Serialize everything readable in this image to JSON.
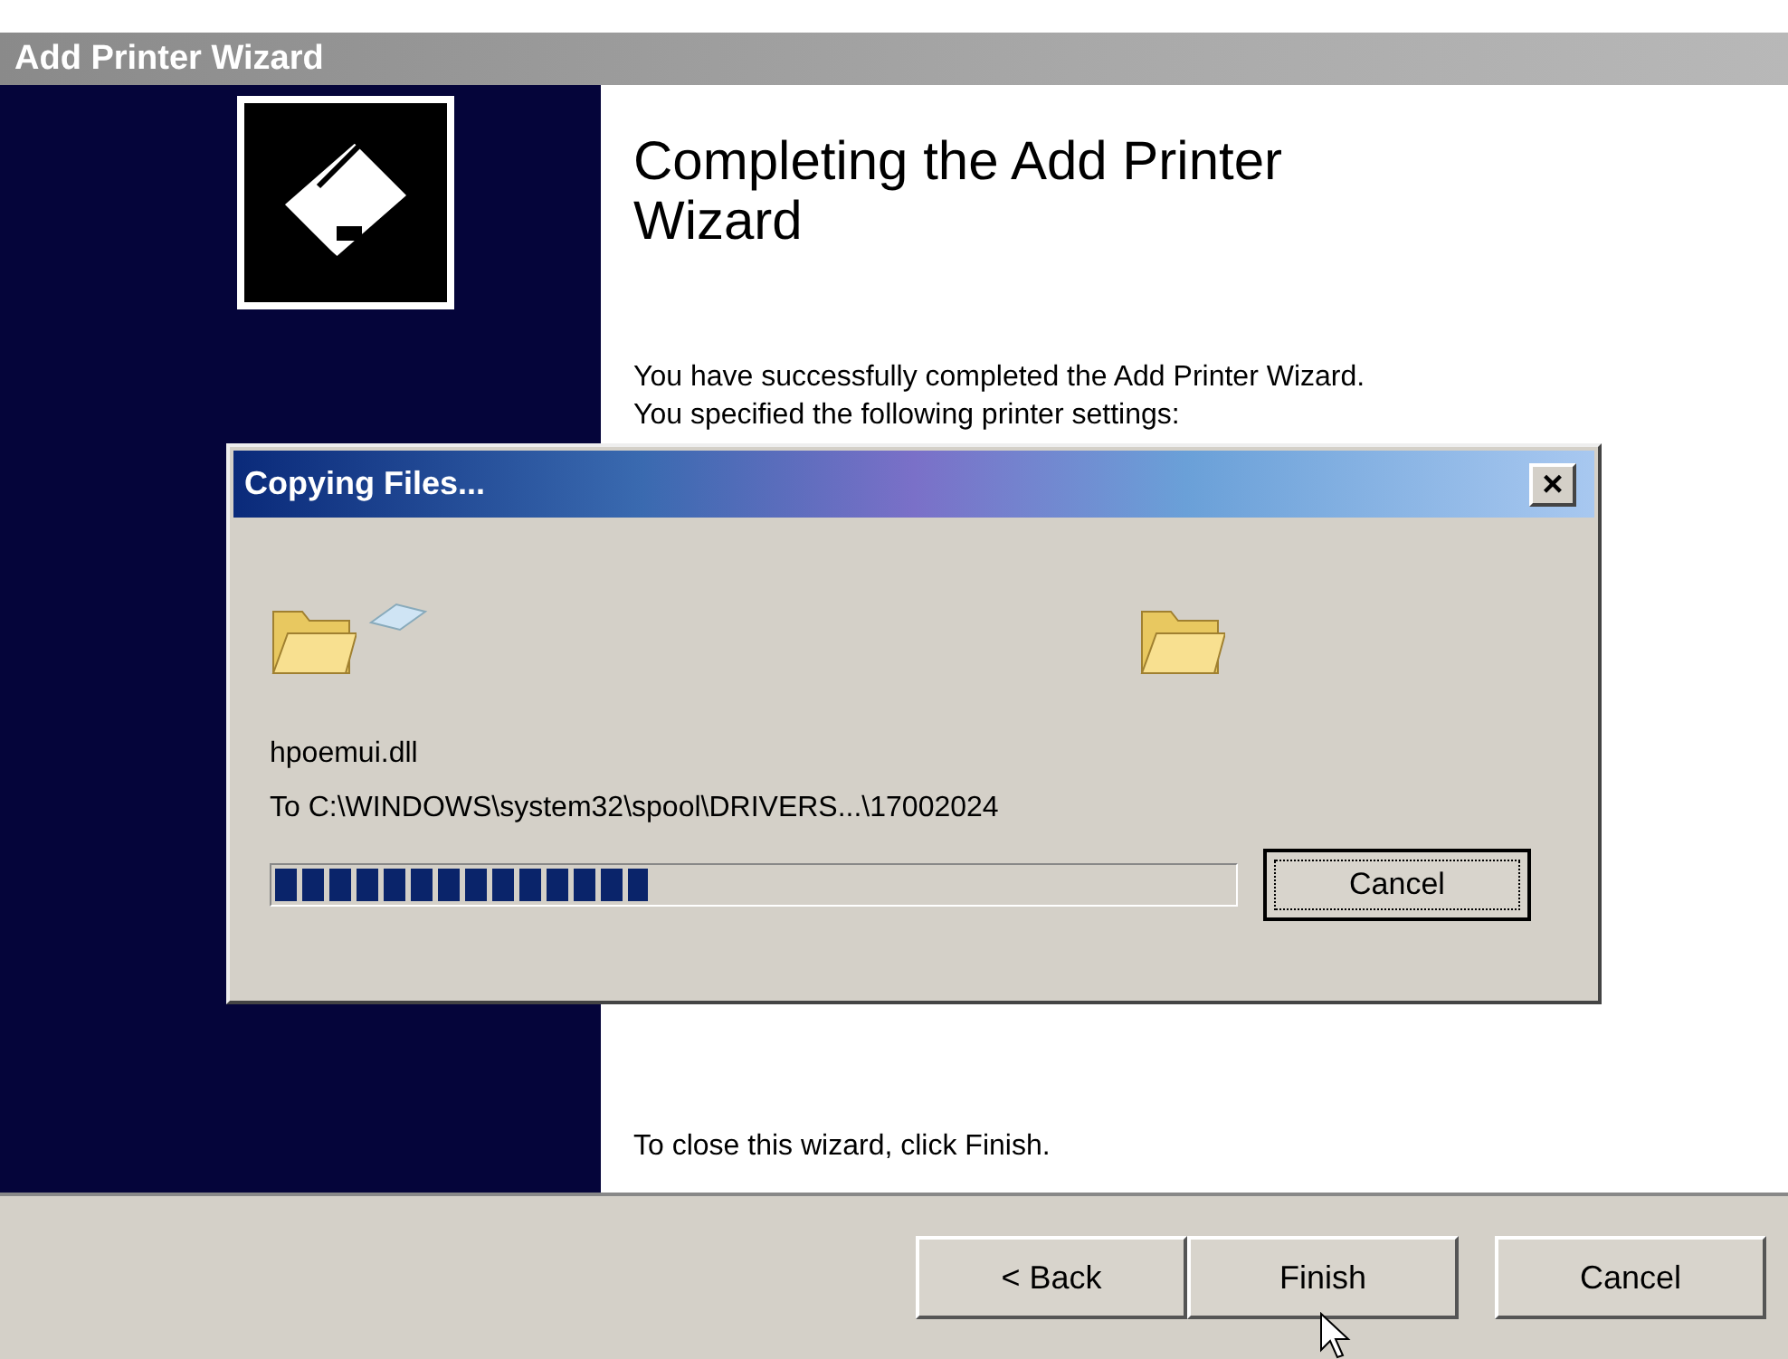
{
  "window": {
    "title": "Add Printer Wizard"
  },
  "wizard": {
    "heading": "Completing the Add Printer Wizard",
    "intro": "You have successfully completed the Add Printer Wizard.",
    "settings_line": "You specified the following printer settings:",
    "closing": "To close this wizard, click Finish."
  },
  "buttons": [
    {
      "label": "< Back",
      "kind": "normal"
    },
    {
      "label": "Finish",
      "kind": "normal"
    },
    {
      "label": "Cancel",
      "kind": "spaced"
    }
  ],
  "dialog": {
    "title": "Copying Files...",
    "close": "×",
    "file": "hpoemui.dll",
    "destination": "To C:\\WINDOWS\\system32\\spool\\DRIVERS...\\17002024",
    "progress": {
      "level": 0.39
    },
    "cancel": "Cancel"
  }
}
